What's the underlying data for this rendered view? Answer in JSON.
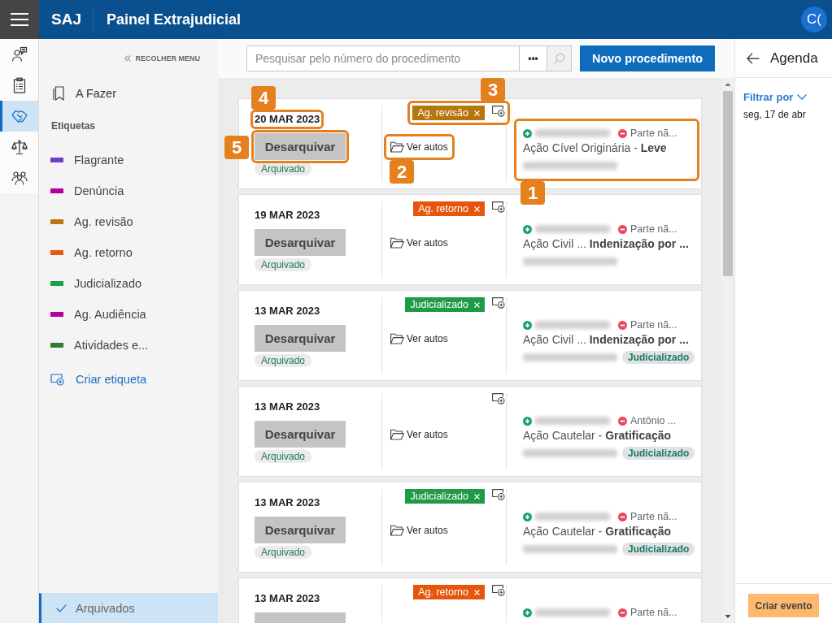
{
  "header": {
    "app": "SAJ",
    "title": "Painel Extrajudicial",
    "avatar": "C("
  },
  "rail": [
    {
      "selected": false
    },
    {
      "selected": false
    },
    {
      "selected": true
    },
    {
      "selected": false
    },
    {
      "selected": false
    }
  ],
  "sidebar": {
    "collapse": "RECOLHER MENU",
    "todo": {
      "label": "A Fazer",
      "selected": false
    },
    "tags_heading": "Etiquetas",
    "tags": [
      {
        "label": "Flagrante",
        "color": "#6c42c1",
        "selected": false
      },
      {
        "label": "Denúncia",
        "color": "#b4009e",
        "selected": false
      },
      {
        "label": "Ag. revisão",
        "color": "#b87707",
        "selected": false
      },
      {
        "label": "Ag. retorno",
        "color": "#e65a0c",
        "selected": false
      },
      {
        "label": "Judicializado",
        "color": "#1e9e4a",
        "selected": false
      },
      {
        "label": "Ag. Audiência",
        "color": "#b4009e",
        "selected": false
      },
      {
        "label": "Atividades e...",
        "color": "#2f7d33",
        "selected": false
      }
    ],
    "create_tag": "Criar etiqueta",
    "archived": {
      "label": "Arquivados",
      "selected": true
    }
  },
  "toolbar": {
    "search": {
      "placeholder": "Pesquisar pelo número do procedimento"
    },
    "more": "•••",
    "search_button": {
      "disabled": true
    },
    "new_button": "Novo procedimento"
  },
  "cards": [
    {
      "date": "20 MAR 2023",
      "button": "Desarquivar",
      "status": "Arquivado",
      "tags": [
        {
          "label": "Ag. revisão",
          "color": "#b5770b"
        }
      ],
      "link": "Ver autos",
      "party": "Parte nã...",
      "title": "Ação Cível Originária - **Leve**",
      "callouts": {
        "date": "4",
        "button": "5",
        "tags": "3",
        "link": "2",
        "parties": "1"
      }
    },
    {
      "date": "19 MAR 2023",
      "button": "Desarquivar",
      "status": "Arquivado",
      "tags": [
        {
          "label": "Ag. retorno",
          "color": "#e5560c"
        }
      ],
      "link": "Ver autos",
      "party": "Parte nã...",
      "title": "Ação Civil ... **Indenização por ...**"
    },
    {
      "date": "13 MAR 2023",
      "button": "Desarquivar",
      "status": "Arquivado",
      "tags": [
        {
          "label": "Judicializado",
          "color": "#1f9a47"
        }
      ],
      "link": "Ver autos",
      "party": "Parte nã...",
      "title": "Ação Civil ... **Indenização por ...**",
      "badge": "Judicializado"
    },
    {
      "date": "13 MAR 2023",
      "button": "Desarquivar",
      "status": "Arquivado",
      "link": "Ver autos",
      "party": "Antônio ...",
      "title": "Ação Cautelar - **Gratificação**",
      "badge": "Judicializado"
    },
    {
      "date": "13 MAR 2023",
      "button": "Desarquivar",
      "status": "Arquivado",
      "tags": [
        {
          "label": "Judicializado",
          "color": "#1f9a47"
        }
      ],
      "link": "Ver autos",
      "party": "Parte nã...",
      "title": "Ação Cautelar - **Gratificação**",
      "badge": "Judicializado"
    },
    {
      "date": "13 MAR 2023",
      "tags": [
        {
          "label": "Ag. retorno",
          "color": "#e5560c"
        }
      ],
      "party": "Parte nã..."
    }
  ],
  "agenda": {
    "title": "Agenda",
    "filter": "Filtrar por",
    "date": "seg, 17 de abr",
    "create_button": "Criar evento"
  }
}
